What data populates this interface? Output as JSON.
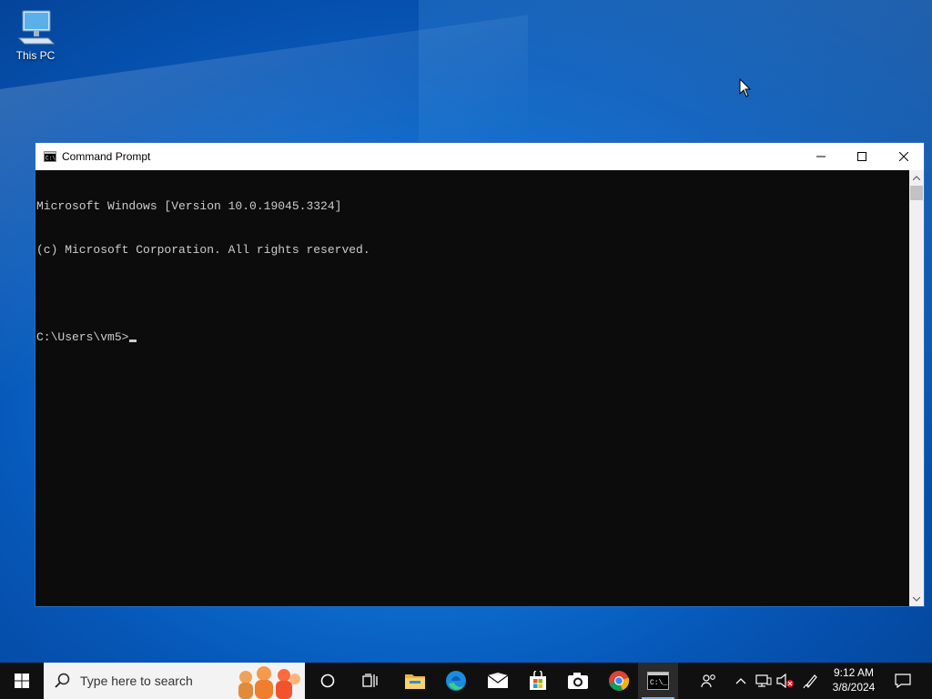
{
  "desktop": {
    "icons": [
      {
        "label": "This PC",
        "icon": "computer-icon"
      }
    ]
  },
  "window": {
    "title": "Command Prompt",
    "icon": "cmd-icon",
    "controls": {
      "minimize": "minimize-icon",
      "maximize": "maximize-icon",
      "close": "close-icon"
    },
    "console_lines": [
      "Microsoft Windows [Version 10.0.19045.3324]",
      "(c) Microsoft Corporation. All rights reserved.",
      "",
      "C:\\Users\\vm5>"
    ]
  },
  "taskbar": {
    "search_placeholder": "Type here to search",
    "apps": [
      {
        "name": "cortana",
        "icon": "circle-icon"
      },
      {
        "name": "task-view",
        "icon": "task-view-icon"
      },
      {
        "name": "file-explorer",
        "icon": "folder-icon"
      },
      {
        "name": "edge",
        "icon": "edge-icon"
      },
      {
        "name": "mail",
        "icon": "mail-icon"
      },
      {
        "name": "store",
        "icon": "store-icon"
      },
      {
        "name": "camera",
        "icon": "camera-icon"
      },
      {
        "name": "chrome",
        "icon": "chrome-icon"
      },
      {
        "name": "command-prompt",
        "icon": "cmd-icon",
        "active": true
      }
    ],
    "tray": {
      "icons": [
        "people-icon",
        "chevron-up-icon",
        "network-icon",
        "volume-muted-icon",
        "pen-icon"
      ],
      "time": "9:12 AM",
      "date": "3/8/2024",
      "notification_icon": "notification-icon"
    }
  },
  "colors": {
    "console_bg": "#0c0c0c",
    "console_fg": "#cccccc",
    "taskbar_bg": "#101010",
    "window_border": "#2b6bbf"
  }
}
